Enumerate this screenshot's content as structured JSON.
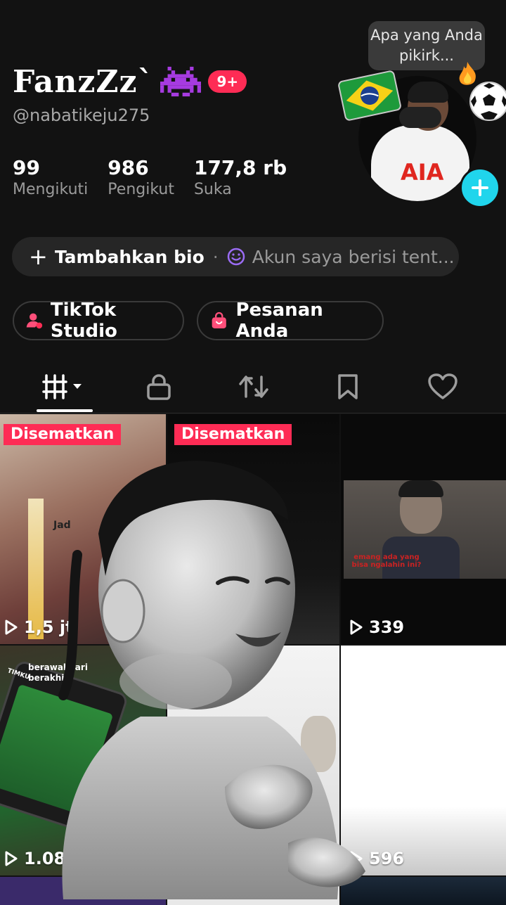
{
  "profile": {
    "display_name": "FanzZz`",
    "notification_badge": "9+",
    "username": "@nabatikeju275",
    "avatar_note_bubble": "Apa yang Anda pikirk...",
    "avatar_jersey_text": "AIA"
  },
  "stats": [
    {
      "value": "99",
      "label": "Mengikuti"
    },
    {
      "value": "986",
      "label": "Pengikut"
    },
    {
      "value": "177,8 rb",
      "label": "Suka"
    }
  ],
  "bio_bar": {
    "add_bio_label": "Tambahkan bio",
    "separator": "·",
    "hint": "Akun saya berisi tent..."
  },
  "shortcuts": {
    "studio_label": "TikTok Studio",
    "orders_label": "Pesanan Anda"
  },
  "tabs": [
    {
      "icon": "grid-icon",
      "active": true
    },
    {
      "icon": "lock-icon",
      "active": false
    },
    {
      "icon": "repost-icon",
      "active": false
    },
    {
      "icon": "bookmark-icon",
      "active": false
    },
    {
      "icon": "heart-icon",
      "active": false
    }
  ],
  "videos": [
    {
      "pinned_label": "Disematkan",
      "views": "1,5 jt",
      "caption_fragment": "Jad"
    },
    {
      "pinned_label": "Disematkan",
      "views": ""
    },
    {
      "views": "339",
      "caption": "emang ada yang bisa ngalahin ini?"
    },
    {
      "views": "1.089",
      "caption": "berawal dari berakhir",
      "extra_text": "TIMKU"
    },
    {
      "views": ""
    },
    {
      "views": "596"
    }
  ],
  "colors": {
    "background": "#121212",
    "accent_red": "#fe2c55",
    "accent_cyan": "#20d5ec"
  }
}
